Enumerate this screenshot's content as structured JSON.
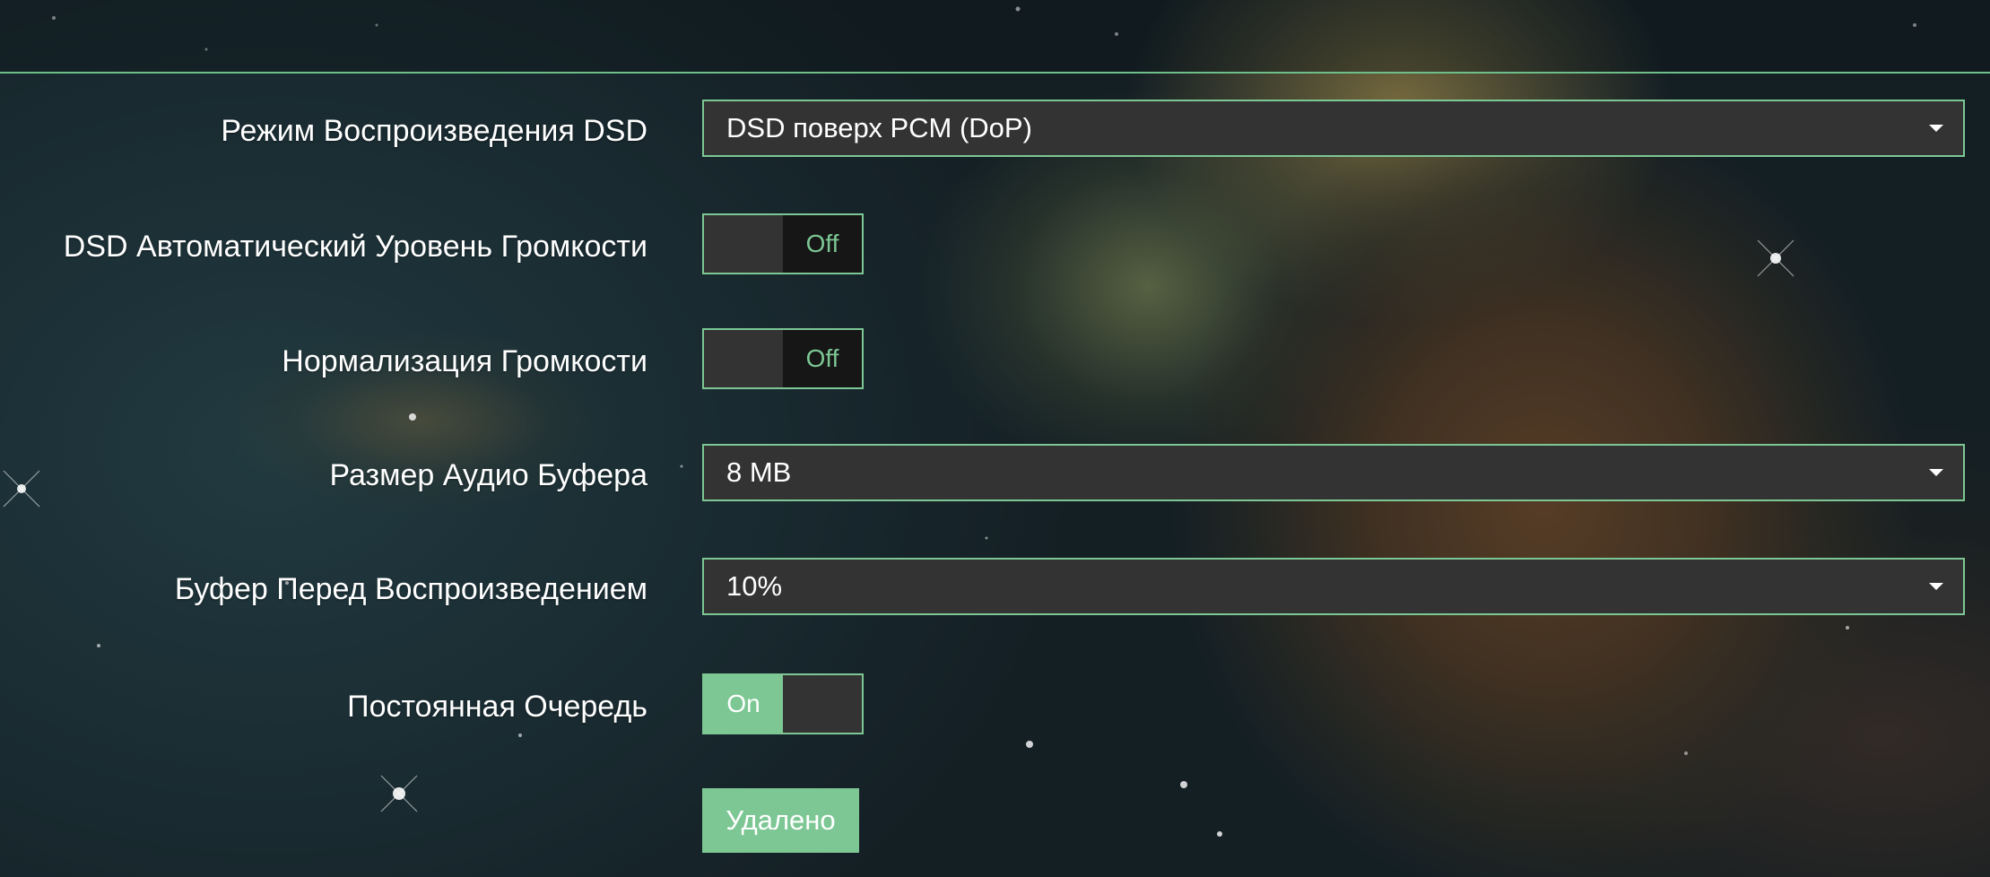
{
  "settings": {
    "dsd_mode": {
      "label": "Режим Воспроизведения DSD",
      "value": "DSD поверх PCM (DoP)"
    },
    "dsd_auto_volume": {
      "label": "DSD Автоматический Уровень Громкости",
      "state": "Off"
    },
    "volume_normalization": {
      "label": "Нормализация Громкости",
      "state": "Off"
    },
    "audio_buffer_size": {
      "label": "Размер Аудио Буфера",
      "value": "8 MB"
    },
    "prebuffer": {
      "label": "Буфер Перед Воспроизведением",
      "value": "10%"
    },
    "persistent_queue": {
      "label": "Постоянная Очередь",
      "state": "On"
    }
  },
  "actions": {
    "submit_label": "Удалено"
  },
  "colors": {
    "accent": "#7cc794",
    "control_bg": "#333333",
    "toggle_off_bg": "#161616"
  },
  "icons": {
    "dropdown": "caret-down-icon"
  }
}
